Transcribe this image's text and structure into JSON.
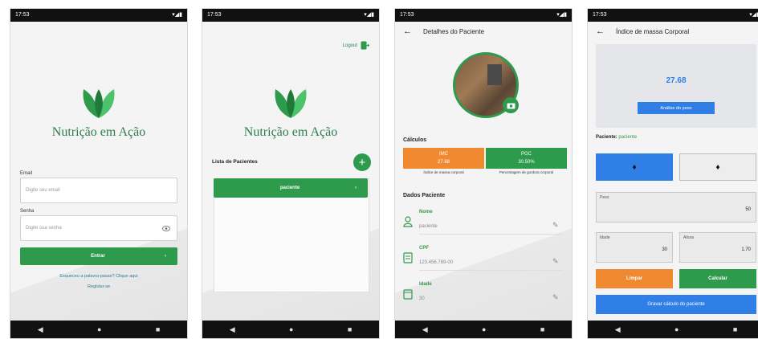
{
  "status": {
    "time": "17:53",
    "icons": "▾◢▮"
  },
  "nav": {
    "back": "◀",
    "home": "●",
    "recent": "■"
  },
  "screen1": {
    "app_title": "Nutrição em Ação",
    "email_label": "Email",
    "email_placeholder": "Digite seu email",
    "password_label": "Senha",
    "password_placeholder": "Digite sua senha",
    "login_button": "Entrar",
    "login_arrow": "›",
    "forgot_link": "Esqueceu a palavra-passe? Clique aqui",
    "register_link": "Registar-se"
  },
  "screen2": {
    "logout_label": "Logout",
    "app_title": "Nutrição em Ação",
    "list_title": "Lista de Pacientes",
    "add_icon": "+",
    "patient_button": "paciente",
    "patient_arrow": "›"
  },
  "screen3": {
    "title": "Detalhes do Paciente",
    "calculos_title": "Cálculos",
    "imc_value": "IMC",
    "imc_sub": "27.68",
    "imc_caption": "Índice de massa corporal",
    "gordura_value": "PGC",
    "gordura_sub": "30.50%",
    "gordura_caption": "Percentagem de gordura corporal",
    "dados_title": "Dados Paciente",
    "fields": [
      {
        "label": "Nome",
        "value": "paciente"
      },
      {
        "label": "CPF",
        "value": "123.456.789-00"
      },
      {
        "label": "Idade",
        "value": "30"
      }
    ]
  },
  "screen4": {
    "title": "Índice de massa Corporal",
    "imc_value": "27.68",
    "result_button": "Análise do peso",
    "patient_label": "Paciente:",
    "patient_name": "paciente",
    "male_icon": "♦",
    "female_icon": "♦",
    "weight_label": "Peso",
    "weight_value": "50",
    "age_label": "Idade",
    "age_value": "30",
    "height_label": "Altura",
    "height_value": "1.70",
    "clear_button": "Limpar",
    "calc_button": "Calcular",
    "save_button": "Gravar cálculo do paciente"
  },
  "colors": {
    "green": "#2e9a4c",
    "orange": "#f0892f",
    "blue": "#2f7fe6"
  }
}
